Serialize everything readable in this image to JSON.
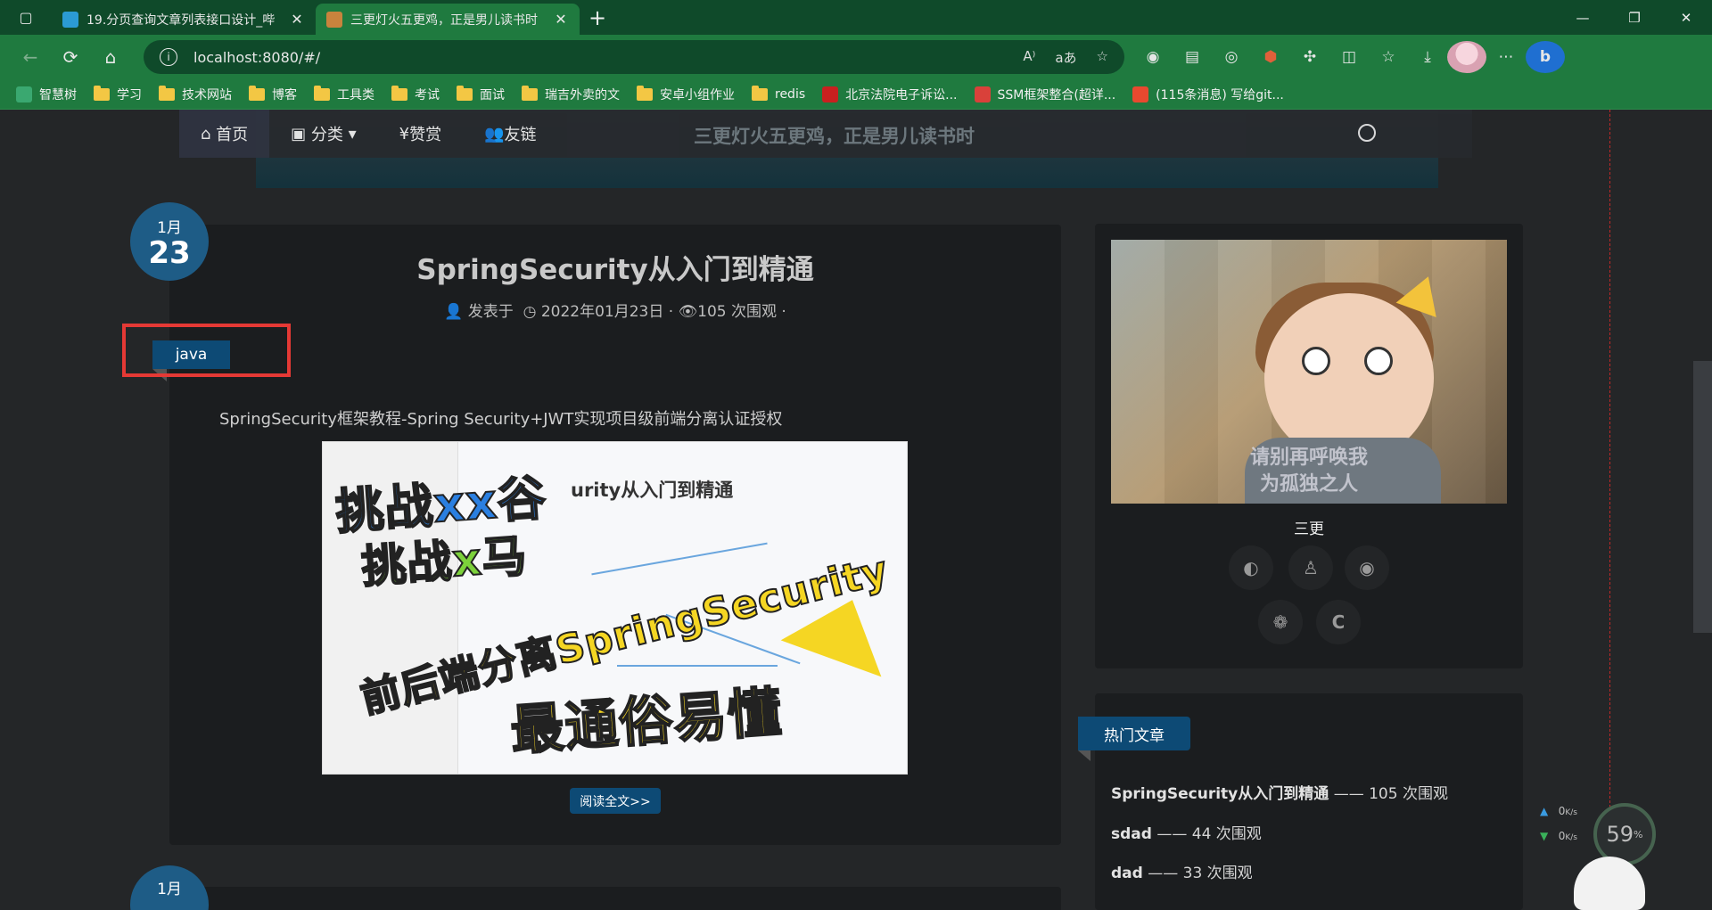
{
  "browser": {
    "tabs": [
      {
        "title": "19.分页查询文章列表接口设计_哔",
        "active": false,
        "icon_color": "#2b9bd3"
      },
      {
        "title": "三更灯火五更鸡，正是男儿读书时",
        "active": true,
        "icon_color": "#c9833d"
      }
    ],
    "new_tab_icon": "plus-icon",
    "url": "localhost:8080/#/",
    "bookmarks": [
      {
        "label": "智慧树",
        "type": "site",
        "color": "#3aa870"
      },
      {
        "label": "学习",
        "type": "folder"
      },
      {
        "label": "技术网站",
        "type": "folder"
      },
      {
        "label": "博客",
        "type": "folder"
      },
      {
        "label": "工具类",
        "type": "folder"
      },
      {
        "label": "考试",
        "type": "folder"
      },
      {
        "label": "面试",
        "type": "folder"
      },
      {
        "label": "瑞吉外卖的文",
        "type": "folder"
      },
      {
        "label": "安卓小组作业",
        "type": "folder"
      },
      {
        "label": "redis",
        "type": "folder"
      },
      {
        "label": "北京法院电子诉讼...",
        "type": "site",
        "color": "#c8201f"
      },
      {
        "label": "SSM框架整合(超详...",
        "type": "site",
        "color": "#d9413a"
      },
      {
        "label": "(115条消息) 写给git...",
        "type": "site",
        "color": "#e8492f"
      }
    ]
  },
  "site": {
    "nav": [
      {
        "label": "首页",
        "icon": "home-icon"
      },
      {
        "label": "分类",
        "icon": "category-icon",
        "dropdown": true
      },
      {
        "label": "赞赏",
        "icon": "yen-icon"
      },
      {
        "label": "友链",
        "icon": "users-icon"
      }
    ],
    "motto": "三更灯火五更鸡，正是男儿读书时"
  },
  "post": {
    "month": "1月",
    "day": "23",
    "title": "SpringSecurity从入门到精通",
    "meta_prefix": "发表于",
    "date": "2022年01月23日",
    "views": "105 次围观",
    "tag": "java",
    "summary": "SpringSecurity框架教程-Spring Security+JWT实现项目级前端分离认证授权",
    "cover": {
      "mindmap_title": "urity从入门到精通",
      "line1": "挑战xx谷",
      "line2": "挑战x马",
      "line3": "前后端分离SpringSecurity",
      "line4": "最通俗易懂"
    },
    "read_more": "阅读全文>>"
  },
  "next_post": {
    "month": "1月"
  },
  "profile": {
    "name": "三更",
    "image_caption_1": "请别再呼唤我",
    "image_caption_2": "为孤独之人",
    "social": [
      "github-icon",
      "qq-icon",
      "weibo-icon",
      "wechat-icon",
      "csdn-icon"
    ]
  },
  "hot": {
    "title": "热门文章",
    "items": [
      {
        "title": "SpringSecurity从入门到精通",
        "sep": "——",
        "views": "105 次围观"
      },
      {
        "title": "sdad",
        "sep": "——",
        "views": "44 次围观"
      },
      {
        "title": "dad",
        "sep": "——",
        "views": "33 次围观"
      }
    ]
  },
  "net_widget": {
    "up": "0",
    "down": "0",
    "unit": "K/s",
    "percent": "59",
    "percent_unit": "%"
  }
}
